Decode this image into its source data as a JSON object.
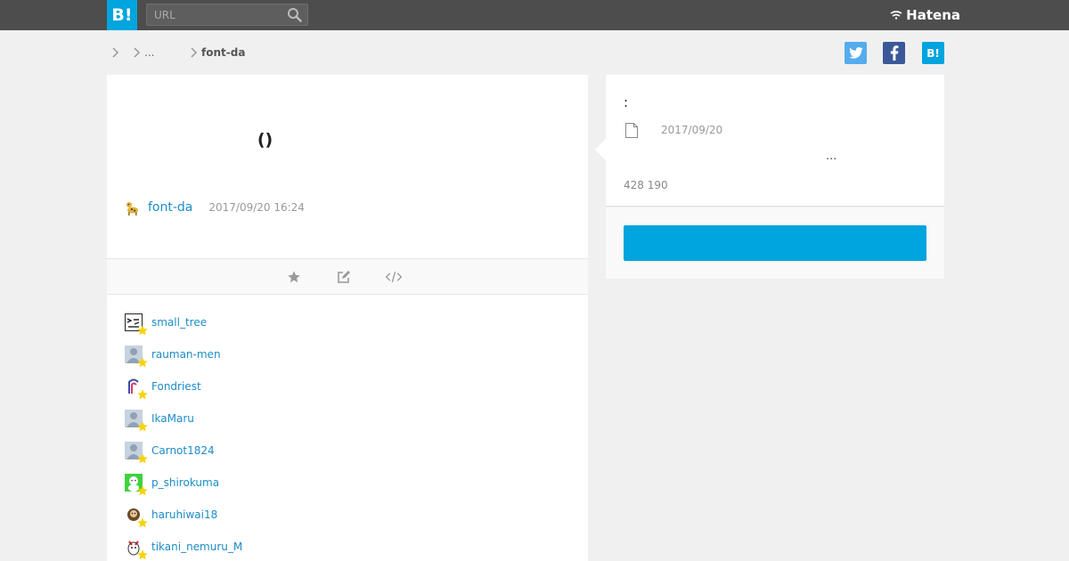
{
  "header": {
    "logo": "B!",
    "search": {
      "placeholder": "URL",
      "value": ""
    },
    "brand": "Hatena"
  },
  "breadcrumb": {
    "items": [
      "",
      "..."
    ],
    "current": "font-da"
  },
  "share": {
    "twitter_icon": "twitter-icon",
    "facebook_icon": "facebook-icon",
    "hatebu_label": "B!"
  },
  "entry": {
    "title": "()",
    "site": "font-da",
    "date": "2017/09/20 16:24"
  },
  "toolbar": {
    "icons": [
      "star-icon",
      "edit-icon",
      "embed-code-icon"
    ]
  },
  "bookmarks": [
    {
      "user": "small_tree"
    },
    {
      "user": "rauman-men"
    },
    {
      "user": "Fondriest"
    },
    {
      "user": "IkaMaru"
    },
    {
      "user": "Carnot1824"
    },
    {
      "user": "p_shirokuma"
    },
    {
      "user": "haruhiwai18"
    },
    {
      "user": "tikani_nemuru_M"
    }
  ],
  "summary": {
    "heading": ":",
    "date": "2017/09/20",
    "ellipsis": "...",
    "counts": "428 190",
    "button_label": ""
  },
  "colors": {
    "brand_blue": "#00a4de",
    "link": "#1a8cc6",
    "topbar": "#4d4d4d"
  }
}
